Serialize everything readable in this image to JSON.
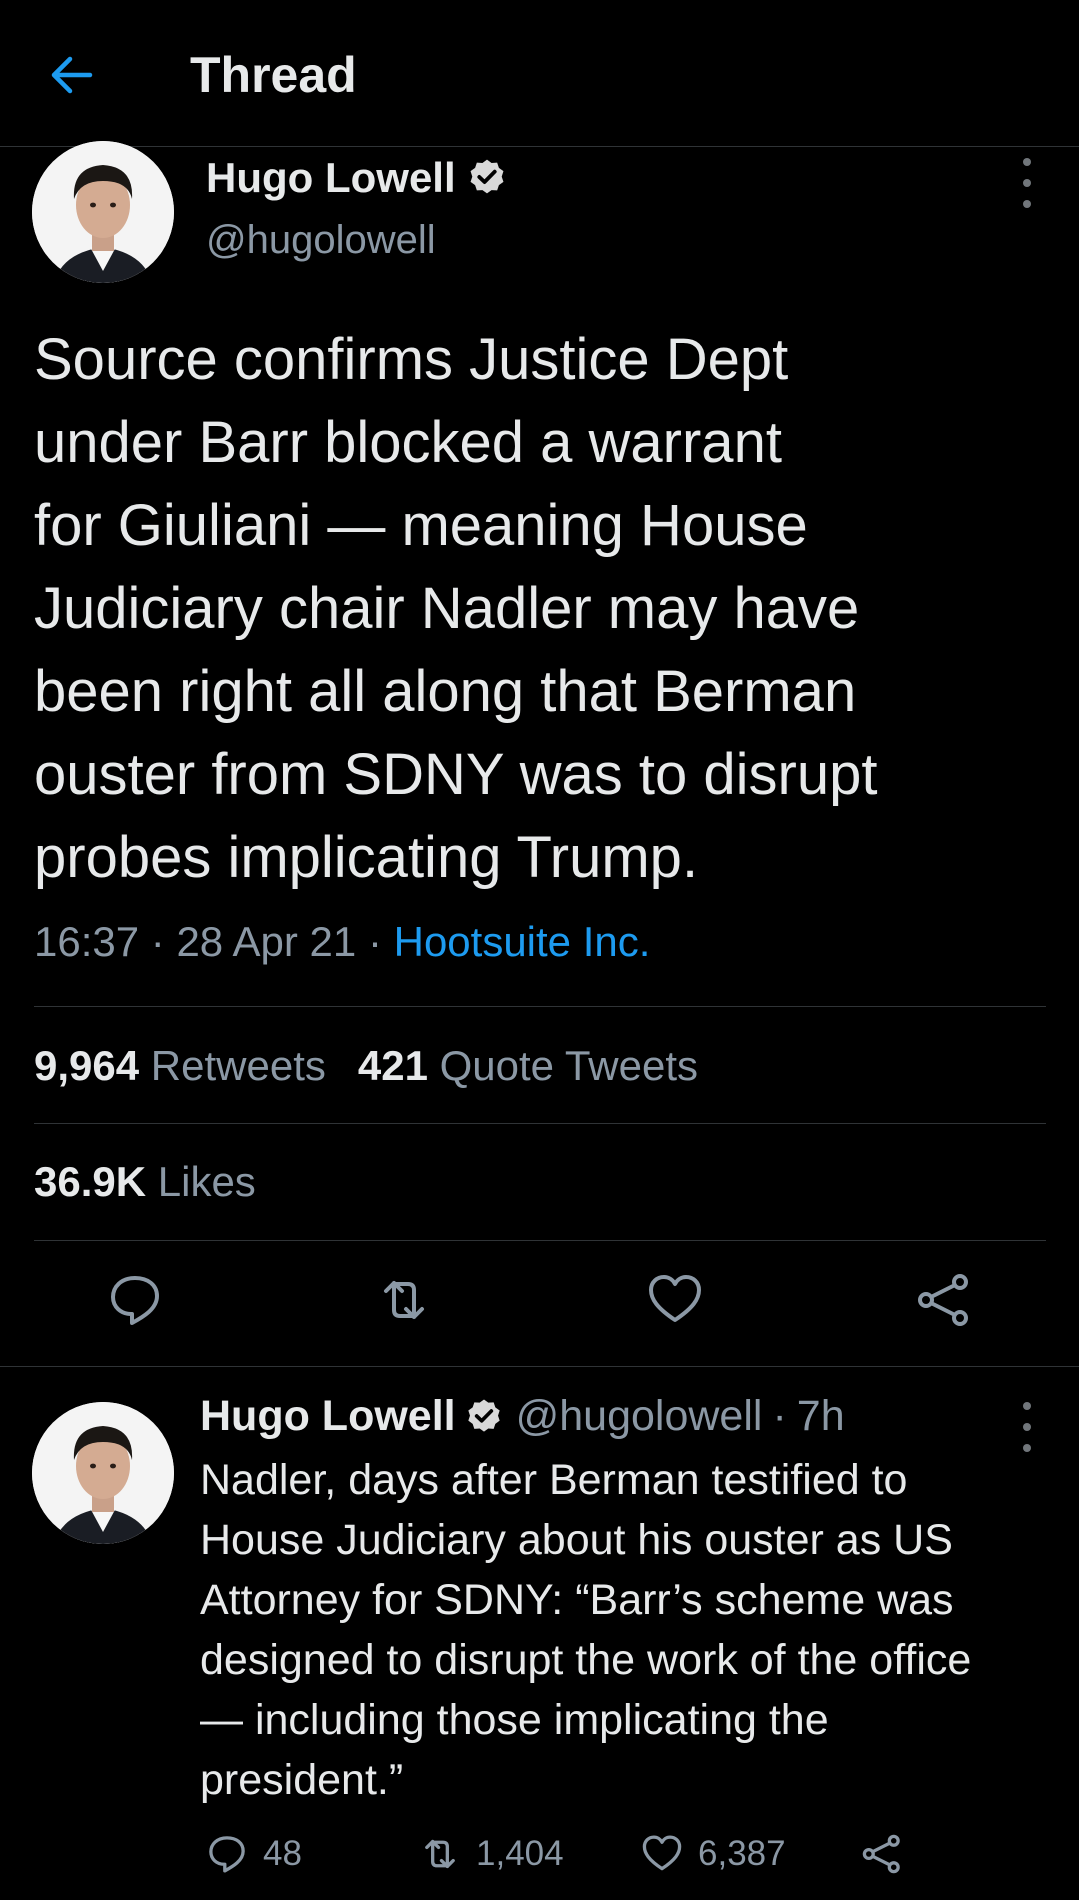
{
  "header": {
    "title": "Thread",
    "back_icon": "arrow-left-icon",
    "accent": "#1d9bf0"
  },
  "main_tweet": {
    "author": {
      "name": "Hugo Lowell",
      "handle": "@hugolowell",
      "verified": true
    },
    "text": "Source confirms Justice Dept\nunder Barr blocked a warrant\nfor Giuliani — meaning House\nJudiciary chair Nadler may have\nbeen right all along that Berman\nouster from SDNY was to disrupt\nprobes implicating Trump.",
    "time": "16:37",
    "date": "28 Apr 21",
    "separator": "·",
    "source": "Hootsuite Inc.",
    "retweets_count": "9,964",
    "retweets_label": "Retweets",
    "quotes_count": "421",
    "quotes_label": "Quote Tweets",
    "likes_count": "36.9K",
    "likes_label": "Likes",
    "actions": [
      "reply-icon",
      "retweet-icon",
      "heart-icon",
      "share-icon"
    ]
  },
  "reply_tweet": {
    "author": {
      "name": "Hugo Lowell",
      "handle": "@hugolowell",
      "age": "7h",
      "verified": true
    },
    "text": "Nadler, days after Berman testified to\nHouse Judiciary about his ouster as US\nAttorney for SDNY: “Barr’s scheme was\ndesigned to disrupt the work of the office\n— including those implicating the\npresident.”",
    "reply_count": "48",
    "retweet_count": "1,404",
    "like_count": "6,387"
  }
}
